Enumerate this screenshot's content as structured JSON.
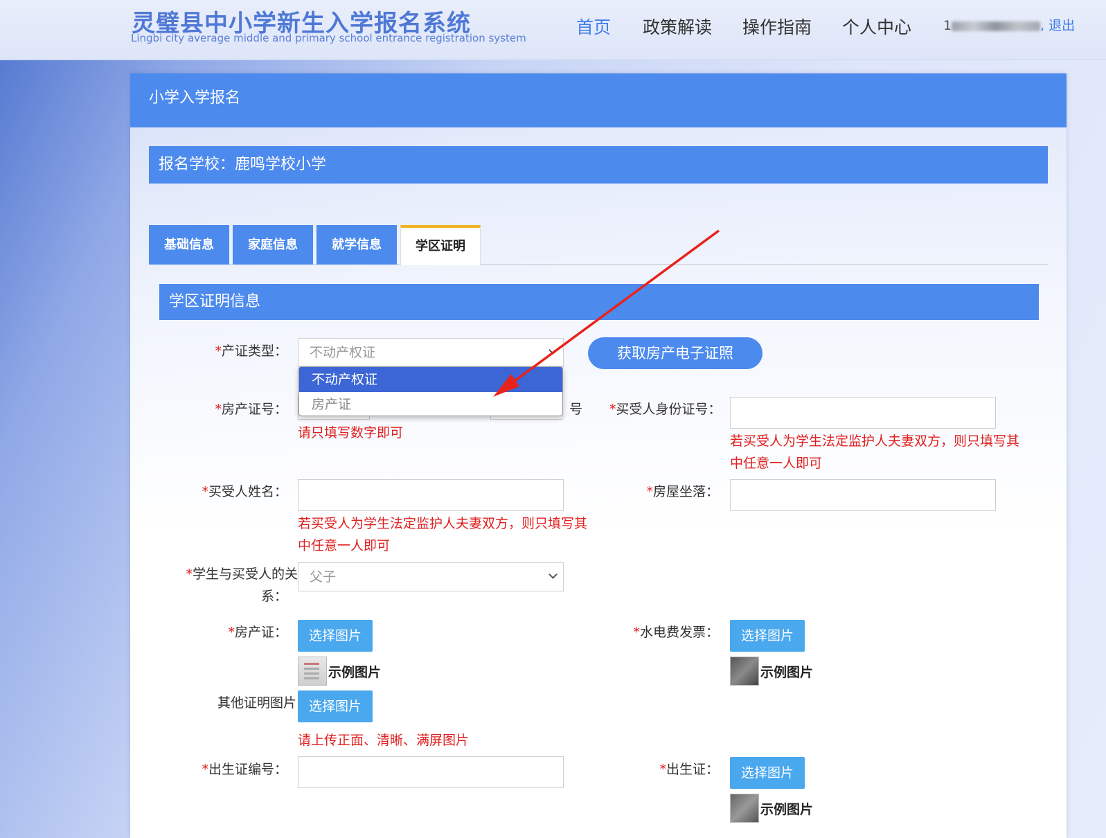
{
  "header": {
    "logo_cn": "灵璧县中小学新生入学报名系统",
    "logo_en": "Lingbi city average middle and primary school entrance registration system",
    "nav": [
      "首页",
      "政策解读",
      "操作指南",
      "个人中心"
    ],
    "user_prefix": "1",
    "logout": ", 退出"
  },
  "panel": {
    "title": "小学入学报名",
    "school": "报名学校：鹿鸣学校小学",
    "tabs": [
      "基础信息",
      "家庭信息",
      "就学信息",
      "学区证明"
    ],
    "active_tab": "学区证明",
    "section": "学区证明信息"
  },
  "form": {
    "cert_type_label": "产证类型：",
    "cert_type_value": "不动产权证",
    "cert_type_options": [
      "不动产权证",
      "房产证"
    ],
    "get_cert_button": "获取房产电子证照",
    "house_no_label": "房产证号：",
    "house_no_suffix": "号",
    "house_no_hint": "请只填写数字即可",
    "buyer_id_label": "买受人身份证号：",
    "buyer_id_hint": "若买受人为学生法定监护人夫妻双方，则只填写其中任意一人即可",
    "buyer_name_label": "买受人姓名：",
    "buyer_name_hint": "若买受人为学生法定监护人夫妻双方，则只填写其中任意一人即可",
    "house_location_label": "房屋坐落：",
    "relation_label_1": "学生与买受人的关",
    "relation_label_2": "系：",
    "relation_value": "父子",
    "house_cert_label": "房产证：",
    "utility_label": "水电费发票：",
    "choose_image": "选择图片",
    "sample_image": "示例图片",
    "other_proof_label": "其他证明图片",
    "upload_hint": "请上传正面、清晰、满屏图片",
    "birth_no_label": "出生证编号：",
    "birth_cert_label": "出生证：",
    "required_mark": "*"
  },
  "colors": {
    "primary": "#4c8aed",
    "accent_tab": "#f0b323",
    "hint_red": "#e02020",
    "upload_btn": "#4aa8ef",
    "annotation_arrow": "#e8231c"
  }
}
